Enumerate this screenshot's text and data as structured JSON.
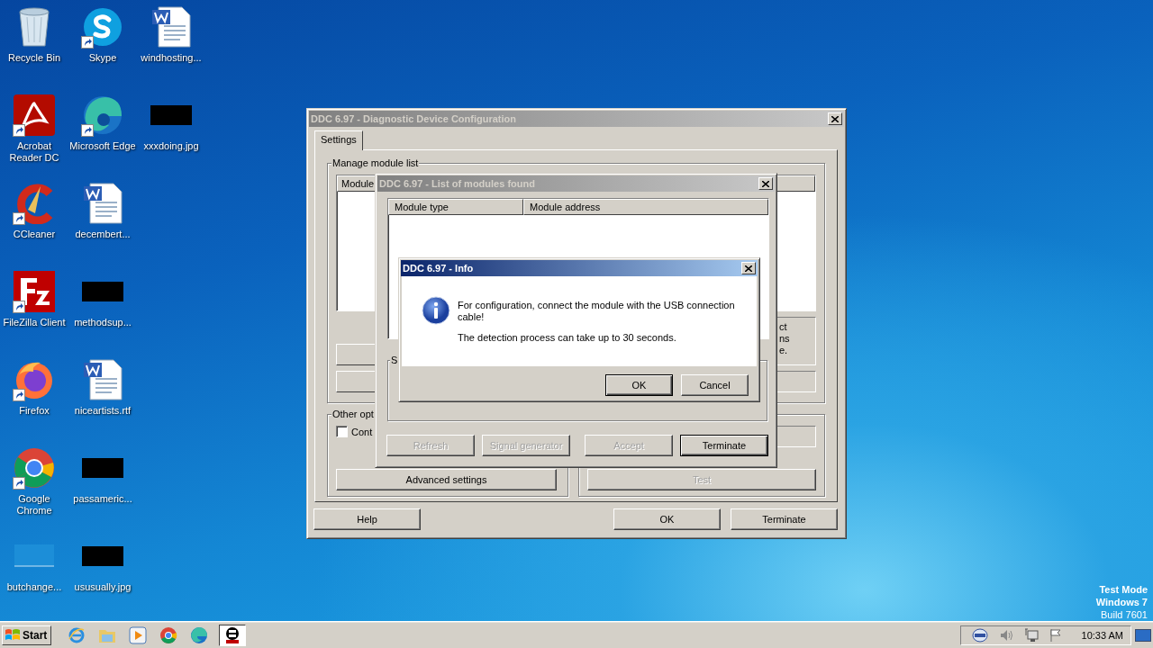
{
  "desktop": {
    "icons": [
      {
        "label": "Recycle Bin",
        "kind": "recycle",
        "shortcut": false
      },
      {
        "label": "Acrobat Reader DC",
        "kind": "acrobat",
        "shortcut": true
      },
      {
        "label": "CCleaner",
        "kind": "ccleaner",
        "shortcut": true
      },
      {
        "label": "FileZilla Client",
        "kind": "filezilla",
        "shortcut": true
      },
      {
        "label": "Firefox",
        "kind": "firefox",
        "shortcut": true
      },
      {
        "label": "Google Chrome",
        "kind": "chrome",
        "shortcut": true
      },
      {
        "label": "butchange...",
        "kind": "blank",
        "shortcut": false
      },
      {
        "label": "Skype",
        "kind": "skype",
        "shortcut": true
      },
      {
        "label": "Microsoft Edge",
        "kind": "edge",
        "shortcut": true
      },
      {
        "label": "decembert...",
        "kind": "word",
        "shortcut": false
      },
      {
        "label": "methodsup...",
        "kind": "redacted",
        "shortcut": false
      },
      {
        "label": "niceartists.rtf",
        "kind": "word",
        "shortcut": false
      },
      {
        "label": "passameric...",
        "kind": "redacted",
        "shortcut": false
      },
      {
        "label": "ususually.jpg",
        "kind": "redacted",
        "shortcut": false
      },
      {
        "label": "windhosting...",
        "kind": "word",
        "shortcut": false
      },
      {
        "label": "xxxdoing.jpg",
        "kind": "redacted",
        "shortcut": false
      }
    ],
    "test_mode": [
      "Test Mode",
      "Windows 7",
      "Build 7601"
    ]
  },
  "main_window": {
    "title": "DDC 6.97 - Diagnostic Device Configuration",
    "active": false,
    "tabs": [
      {
        "label": "Settings",
        "selected": true
      }
    ],
    "module_group": {
      "title": "Manage module list",
      "column_1": "Module",
      "side_text": [
        "ct",
        "ns",
        "e."
      ]
    },
    "options_group": {
      "title": "Other opt",
      "checkbox": {
        "label": "Cont",
        "checked": false
      },
      "button": {
        "label": "Advanced settings",
        "disabled": false
      }
    },
    "test_group": {
      "button": {
        "label": "Test",
        "disabled": true
      }
    },
    "buttons": [
      {
        "label": "Help"
      },
      {
        "label": "OK"
      },
      {
        "label": "Terminate"
      }
    ]
  },
  "list_window": {
    "title": "DDC 6.97 - List of modules found",
    "active": false,
    "columns": [
      "Module type",
      "Module address"
    ],
    "group_title": "S",
    "buttons": [
      {
        "label": "Refresh",
        "disabled": true,
        "default": false
      },
      {
        "label": "Signal generator",
        "disabled": true,
        "default": false
      },
      {
        "label": "Accept",
        "disabled": true,
        "default": false
      },
      {
        "label": "Terminate",
        "disabled": false,
        "default": true
      }
    ]
  },
  "info_window": {
    "title": "DDC 6.97 - Info",
    "active": true,
    "message": [
      "For configuration, connect the module with the USB connection cable!",
      "The detection process can take up to 30 seconds."
    ],
    "buttons": [
      {
        "label": "OK",
        "disabled": false,
        "default": true
      },
      {
        "label": "Cancel",
        "disabled": false,
        "default": false
      }
    ]
  },
  "taskbar": {
    "start": "Start",
    "apps": [
      {
        "kind": "ie",
        "active": false
      },
      {
        "kind": "explorer",
        "active": false
      },
      {
        "kind": "media",
        "active": false
      },
      {
        "kind": "chrome",
        "active": false
      },
      {
        "kind": "edge",
        "active": false
      },
      {
        "kind": "ddc",
        "active": true
      }
    ],
    "time": "10:33 AM"
  }
}
